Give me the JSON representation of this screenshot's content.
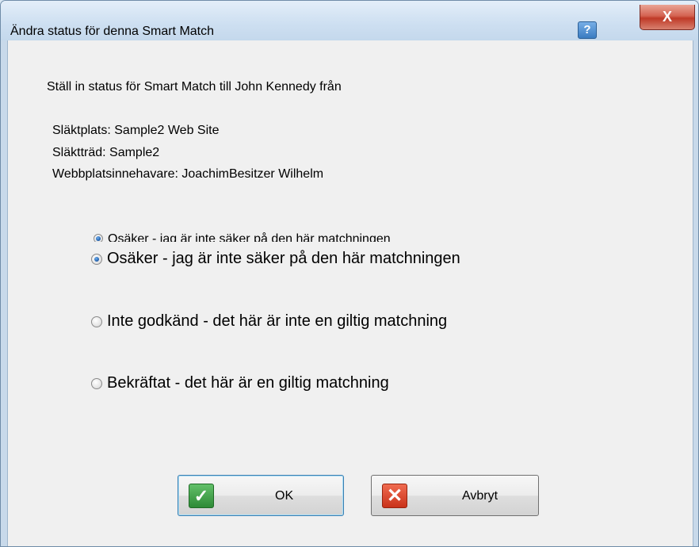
{
  "dialog": {
    "title": "Ändra status för denna Smart Match",
    "help_label": "?",
    "close_label": "X"
  },
  "content": {
    "intro": "Ställ in status för Smart Match till John Kennedy från",
    "site_line": "Släktplats: Sample2 Web Site",
    "tree_line": "Släktträd: Sample2",
    "manager_line": "Webbplatsinnehavare: JoachimBesitzer Wilhelm"
  },
  "options": {
    "ghost_label": "Osäker - jag är inte säker på den här matchningen",
    "uncertain_label": "Osäker - jag är inte säker på den här matchningen",
    "rejected_label": "Inte godkänd - det här är inte en giltig matchning",
    "confirmed_label": "Bekräftat - det här är en giltig matchning",
    "selected": "uncertain"
  },
  "buttons": {
    "ok_label": "OK",
    "cancel_label": "Avbryt"
  },
  "icons": {
    "help": "help-icon",
    "close": "close-icon",
    "ok": "checkmark-icon",
    "cancel": "x-icon"
  },
  "colors": {
    "titlebar": "#cddff1",
    "client_background": "#f0f0f0",
    "close_button": "#c8432f",
    "help_button": "#3a7cc2",
    "ok_icon": "#3c9a43",
    "cancel_icon": "#d9452a"
  }
}
